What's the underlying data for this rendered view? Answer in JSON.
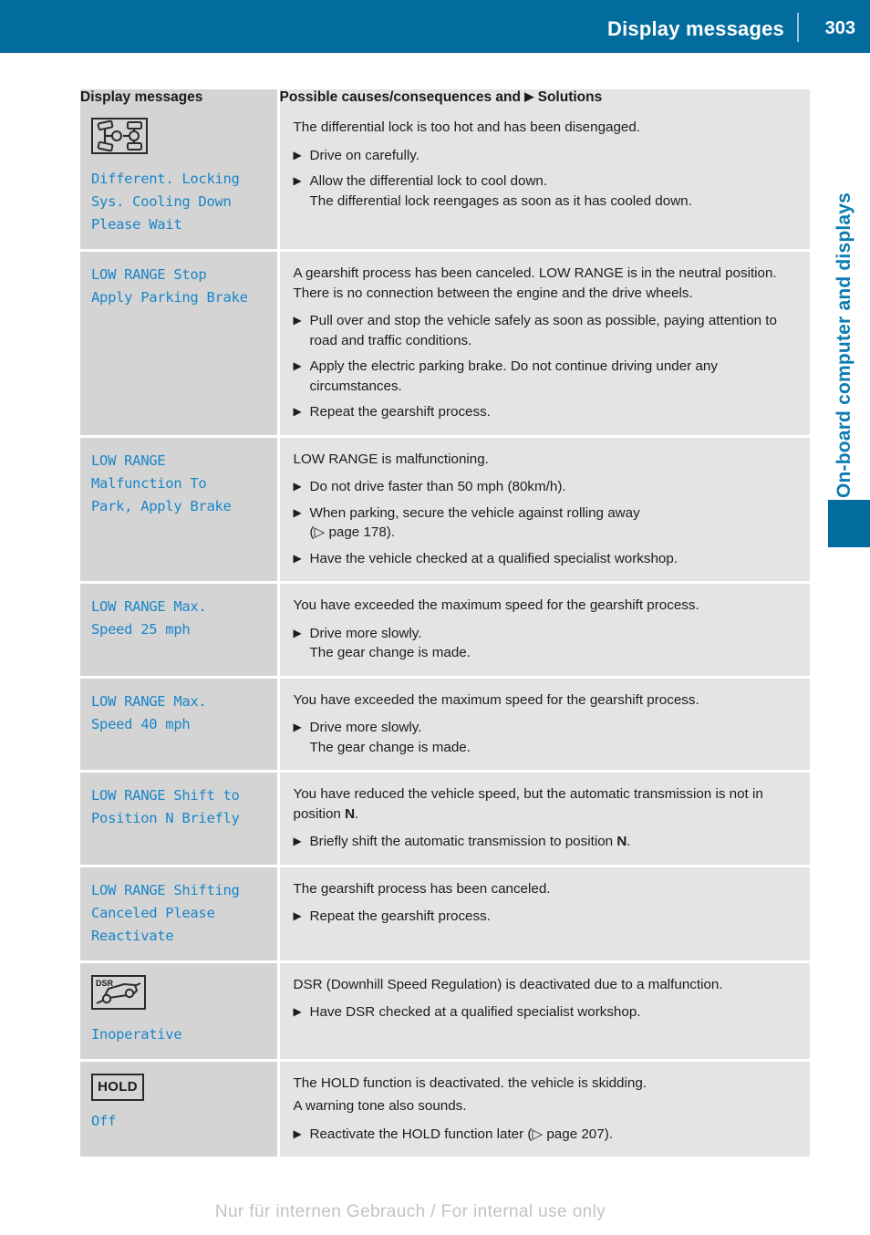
{
  "header": {
    "title": "Display messages",
    "page_number": "303"
  },
  "side_chapter": {
    "label": "On-board computer and displays"
  },
  "footer": {
    "note": "Nur für internen Gebrauch / For internal use only"
  },
  "glyphs": {
    "solid_triangle": "▶",
    "hollow_triangle": "▷"
  },
  "table": {
    "header": {
      "col1": "Display messages",
      "col2_pre": "Possible causes/consequences and",
      "col2_post": "Solutions"
    },
    "rows": [
      {
        "icon": "differential-lock-icon",
        "message": "Different. Locking\nSys. Cooling Down\nPlease Wait",
        "paragraphs": [
          "The differential lock is too hot and has been disengaged."
        ],
        "steps": [
          {
            "text": "Drive on carefully.",
            "sub": ""
          },
          {
            "text": "Allow the differential lock to cool down.",
            "sub": "The differential lock reengages as soon as it has cooled down."
          }
        ]
      },
      {
        "icon": "",
        "message": "LOW RANGE Stop\nApply Parking Brake",
        "paragraphs": [
          "A gearshift process has been canceled. LOW RANGE is in the neutral position. There is no connection between the engine and the drive wheels."
        ],
        "steps": [
          {
            "text": "Pull over and stop the vehicle safely as soon as possible, paying attention to road and traffic conditions.",
            "sub": ""
          },
          {
            "text": "Apply the electric parking brake. Do not continue driving under any circumstances.",
            "sub": ""
          },
          {
            "text": "Repeat the gearshift process.",
            "sub": ""
          }
        ]
      },
      {
        "icon": "",
        "message": "LOW RANGE\nMalfunction To\nPark, Apply Brake",
        "paragraphs": [
          "LOW RANGE is malfunctioning."
        ],
        "steps": [
          {
            "text": "Do not drive faster than 50 mph (80km/h).",
            "sub": ""
          },
          {
            "text": "When parking, secure the vehicle against rolling away",
            "sub": "(▷ page 178)."
          },
          {
            "text": "Have the vehicle checked at a qualified specialist workshop.",
            "sub": ""
          }
        ]
      },
      {
        "icon": "",
        "message": "LOW RANGE Max.\nSpeed 25 mph",
        "paragraphs": [
          "You have exceeded the maximum speed for the gearshift process."
        ],
        "steps": [
          {
            "text": "Drive more slowly.",
            "sub": "The gear change is made."
          }
        ]
      },
      {
        "icon": "",
        "message": "LOW RANGE Max.\nSpeed 40 mph",
        "paragraphs": [
          "You have exceeded the maximum speed for the gearshift process."
        ],
        "steps": [
          {
            "text": "Drive more slowly.",
            "sub": "The gear change is made."
          }
        ]
      },
      {
        "icon": "",
        "message": "LOW RANGE Shift to\nPosition N Briefly",
        "paragraphs": [
          "You have reduced the vehicle speed, but the automatic transmission is not in position N."
        ],
        "steps": [
          {
            "text": "Briefly shift the automatic transmission to position N.",
            "sub": ""
          }
        ]
      },
      {
        "icon": "",
        "message": "LOW RANGE Shifting\nCanceled Please\nReactivate",
        "paragraphs": [
          "The gearshift process has been canceled."
        ],
        "steps": [
          {
            "text": "Repeat the gearshift process.",
            "sub": ""
          }
        ]
      },
      {
        "icon": "dsr-downhill-icon",
        "icon_label": "DSR",
        "message": "Inoperative",
        "paragraphs": [
          "DSR (Downhill Speed Regulation) is deactivated due to a malfunction."
        ],
        "steps": [
          {
            "text": "Have DSR checked at a qualified specialist workshop.",
            "sub": ""
          }
        ]
      },
      {
        "icon": "hold-icon",
        "icon_label": "HOLD",
        "message": "Off",
        "paragraphs": [
          "The HOLD function is deactivated. the vehicle is skidding.",
          "A warning tone also sounds."
        ],
        "steps": [
          {
            "text": "Reactivate the HOLD function later (▷ page 207).",
            "sub": ""
          }
        ]
      }
    ]
  }
}
